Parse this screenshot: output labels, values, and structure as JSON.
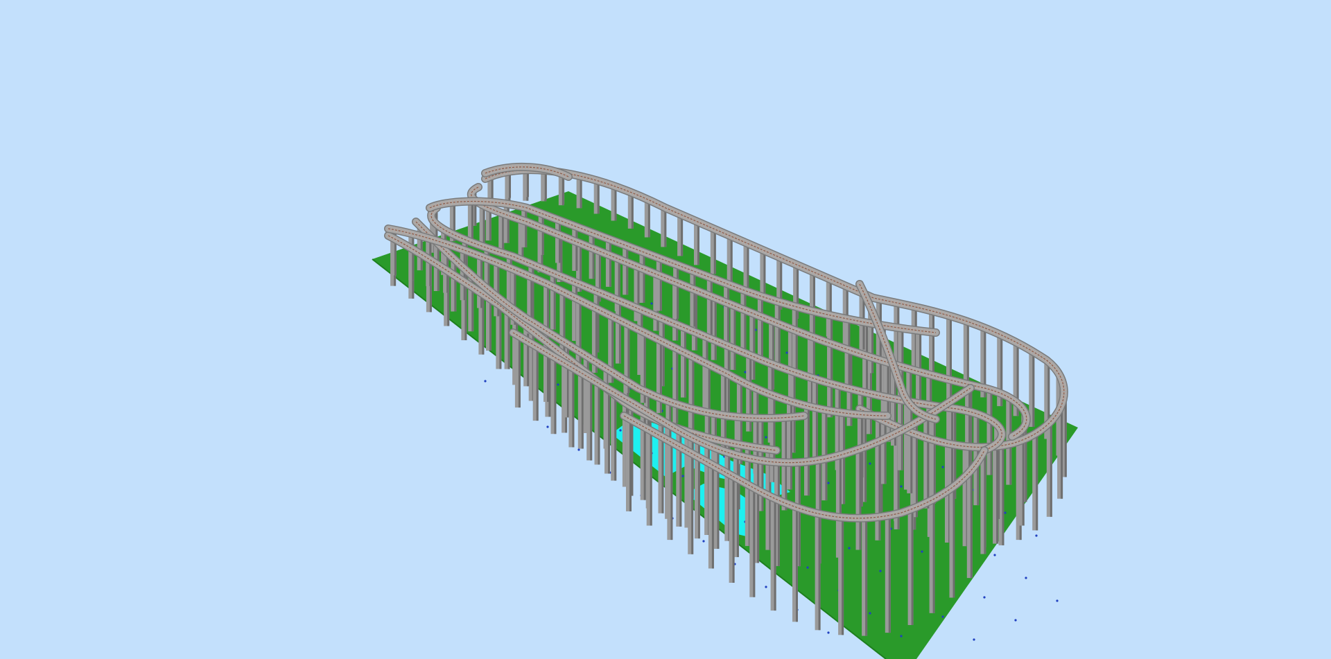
{
  "viewport": {
    "background_color": "#c3e0fc"
  },
  "scene": {
    "baseboard_color": "#2a9a2a",
    "baseboard_edge_color": "#1e7f1e",
    "water_color": "#1ef0f0",
    "pier_color": "#9a9a9a",
    "pier_shade_color": "#6e6e6e",
    "roadbed_color": "#a8a8a8",
    "rail_color": "#8a5a48",
    "tie_color": "#b8a8a0",
    "marker_color": "#2040c0"
  }
}
